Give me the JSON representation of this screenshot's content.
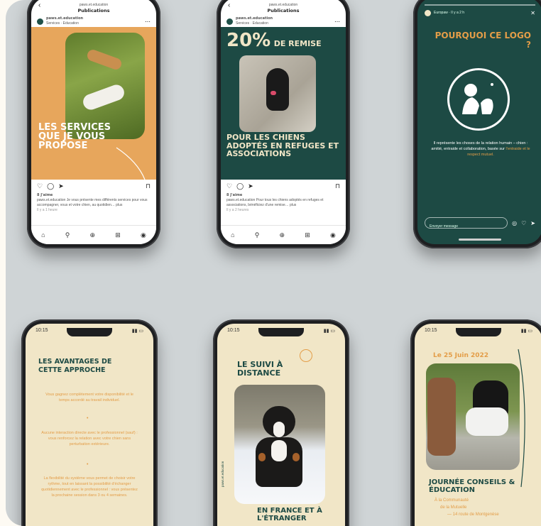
{
  "phones": {
    "p1": {
      "header_title": "Publications",
      "header_sub": "paws.et.education",
      "account": "paws.et.education",
      "account_sub": "Services · Education",
      "post_text": "LES SERVICES QUE JE VOUS PROPOSE",
      "likes": "8 J'aime",
      "caption": "paws.et.education Je vous présente mes différents services pour vous accompagner, vous et votre chien, au quotidien… plus",
      "time": "Il y a 1 heure"
    },
    "p2": {
      "header_title": "Publications",
      "header_sub": "paws.et.education",
      "account": "paws.et.education",
      "account_sub": "Services · Education",
      "promo_big": "20%",
      "promo_small": "DE REMISE",
      "post_text": "POUR LES CHIENS ADOPTÉS EN REFUGES ET ASSOCIATIONS",
      "likes": "8 J'aime",
      "caption": "paws.et.education Pour tous les chiens adoptés en refuges et associations, bénéficiez d'une remise… plus",
      "time": "Il y a 2 heures"
    },
    "p3": {
      "story_user": "Europaw · Il y a 2 h",
      "title": "POURQUOI CE LOGO ?",
      "body": "Il représente les choses de la relation humain – chien : amitié, entraide et collaboration, basée sur",
      "body_highlight": "l'entraide et le respect mutuel.",
      "reply_placeholder": "Envoyer message"
    },
    "p4": {
      "time": "10:15",
      "title": "LES AVANTAGES DE CETTE APPROCHE",
      "para1": "Vous gagnez complètement votre disponibilité et le temps accordé au travail individuel.",
      "para2": "Aucune interaction directe avec le professionnel (sauf) : vous renforcez la relation avec votre chien sans perturbation extérieure.",
      "para3": "La flexibilité du système vous permet de choisir votre rythme, tout en laissant la possibilité d'échanger quotidiennement avec le professionnel : vous présentez la prochaine session dans 3 ou 4 semaines."
    },
    "p5": {
      "time": "10:15",
      "title": "LE SUIVI À DISTANCE",
      "bottom": "EN FRANCE ET À L'ÉTRANGER",
      "side": "paws.et.education"
    },
    "p6": {
      "time": "10:15",
      "date": "Le 25 Juin 2022",
      "title": "JOURNÉE CONSEILS & ÉDUCATION",
      "line1": "À la Communauté",
      "line2": "de la Mutuelle",
      "line3": "— 14 route de Montgenèse"
    }
  },
  "colors": {
    "board": "#cfd4d6",
    "green": "#1d4a44",
    "orange": "#e7a65c",
    "cream": "#f1e6c7"
  }
}
